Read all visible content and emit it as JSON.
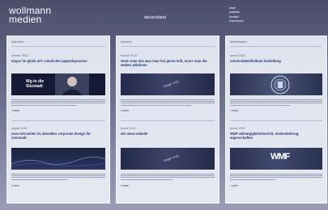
{
  "brand": {
    "line1": "wollmann",
    "line2": "medien"
  },
  "locale": "deutschland",
  "topnav": [
    "team",
    "projekte",
    "kontakt",
    "impressum"
  ],
  "panels": [
    {
      "title": "aktuelles",
      "articles": [
        {
          "date": "oktober 2015",
          "headline": "mayer im glück mit «sinnlicher jugendsprache»",
          "banner_text": "Wg in die Sitzstadt",
          "more": "» mehr"
        },
        {
          "date": "august 2015",
          "headline": "neue lehrseiten im aktuellen corporate design für sinnstadt",
          "more": "» mehr"
        }
      ]
    },
    {
      "title": "lyrische",
      "articles": [
        {
          "date": "februar 2015",
          "headline": "wenn man das was man hat gerne teilt, muss man die welten ablehnen",
          "banner_text": "image copy",
          "more": "» mehr"
        },
        {
          "date": "januar 2015",
          "headline": "die neue website",
          "banner_text": "image copy",
          "more": "» mehr"
        }
      ]
    },
    {
      "title": "lieblinkeiten",
      "articles": [
        {
          "date": "januar 2015",
          "headline": "universitätsklinikum heidelberg",
          "more": "» mehr"
        },
        {
          "date": "januar 2015",
          "headline": "WMF abhängigkeitsbericht, medienbeitrag, eigenschaften",
          "banner_text": "WMF",
          "more": "» mehr"
        }
      ]
    }
  ],
  "colors": {
    "headline": "#2c3a78",
    "banner_dark": "#1c2340"
  }
}
